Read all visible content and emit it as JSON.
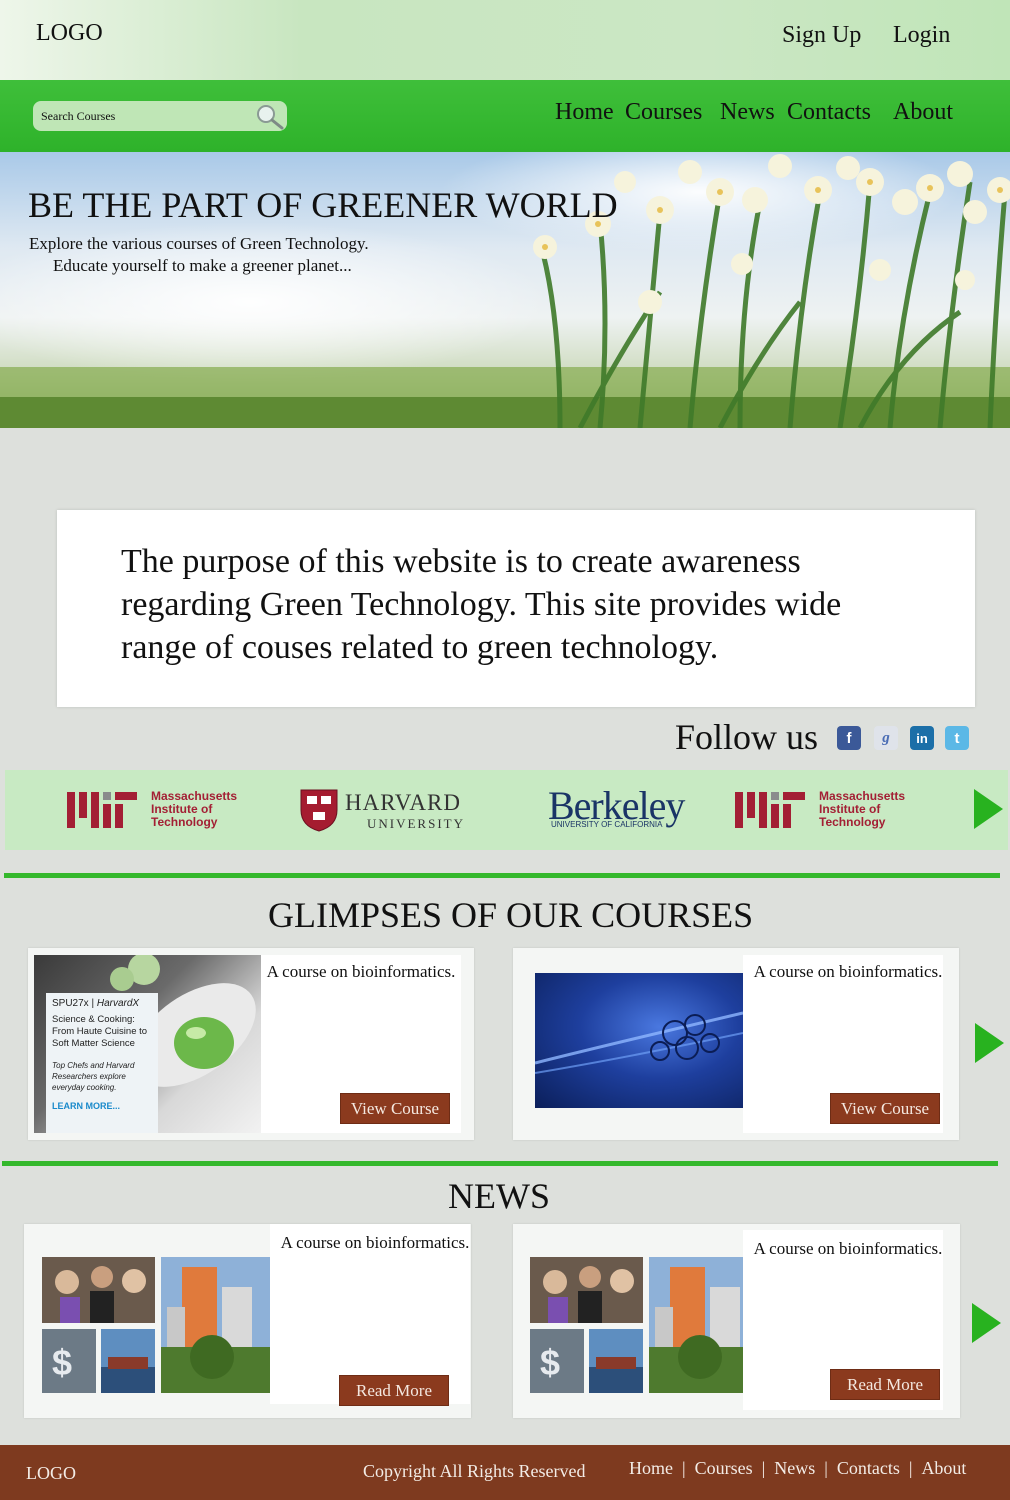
{
  "header": {
    "logo": "LOGO",
    "signup": "Sign Up",
    "login": "Login"
  },
  "nav": {
    "search_placeholder": "Search Courses",
    "items": [
      "Home",
      "Courses",
      "News",
      "Contacts",
      "About"
    ]
  },
  "hero": {
    "title": "BE THE PART OF GREENER WORLD",
    "subtitle_line1": "Explore the various courses of Green Technology.",
    "subtitle_line2": "Educate yourself to make a greener planet..."
  },
  "about": {
    "text": "The purpose of this website is to create awareness regarding Green Technology. This site provides wide range of couses related to green technology."
  },
  "follow": {
    "label": "Follow us",
    "icons": [
      "facebook-icon",
      "google-icon",
      "linkedin-icon",
      "twitter-icon"
    ]
  },
  "partners": {
    "mit": [
      "Massachusetts",
      "Institute of",
      "Technology"
    ],
    "harvard": {
      "name": "HARVARD",
      "sub": "UNIVERSITY"
    },
    "berkeley": {
      "name": "Berkeley",
      "sub": "UNIVERSITY OF CALIFORNIA"
    }
  },
  "courses": {
    "title": "GLIMPSES OF OUR COURSES",
    "items": [
      {
        "text": "A course on bioinformatics.",
        "button": "View Course",
        "image": {
          "code": "SPU27x",
          "org": "HarvardX",
          "title": "Science & Cooking: From Haute Cuisine to Soft Matter Science",
          "desc": "Top Chefs and Harvard Researchers explore everyday cooking.",
          "link": "LEARN MORE..."
        }
      },
      {
        "text": "A course on bioinformatics.",
        "button": "View Course"
      }
    ]
  },
  "news": {
    "title": "NEWS",
    "items": [
      {
        "text": "A course on bioinformatics.",
        "button": "Read More"
      },
      {
        "text": "A course on bioinformatics.",
        "button": "Read More"
      }
    ]
  },
  "footer": {
    "logo": "LOGO",
    "copyright": "Copyright All Rights Reserved",
    "links": [
      "Home",
      "Courses",
      "News",
      "Contacts",
      "About"
    ]
  },
  "colors": {
    "nav_green": "#2eb22a",
    "button_brown": "#8b3a1e",
    "footer_brown": "#7e3a1f",
    "partner_strip": "#c8eac3"
  }
}
